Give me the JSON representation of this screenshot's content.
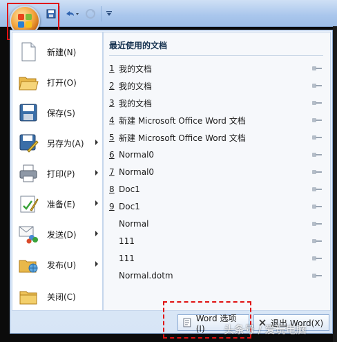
{
  "qat": {
    "save_icon": "save-icon",
    "undo_icon": "undo-icon",
    "redo_icon": "redo-icon",
    "customize_icon": "customize-qat-icon"
  },
  "menu": {
    "commands": [
      {
        "label": "新建(N)",
        "icon": "new-doc-icon",
        "has_submenu": false
      },
      {
        "label": "打开(O)",
        "icon": "open-folder-icon",
        "has_submenu": false
      },
      {
        "label": "保存(S)",
        "icon": "save-disk-icon",
        "has_submenu": false
      },
      {
        "label": "另存为(A)",
        "icon": "save-as-icon",
        "has_submenu": true
      },
      {
        "label": "打印(P)",
        "icon": "print-icon",
        "has_submenu": true
      },
      {
        "label": "准备(E)",
        "icon": "prepare-icon",
        "has_submenu": true
      },
      {
        "label": "发送(D)",
        "icon": "send-icon",
        "has_submenu": true
      },
      {
        "label": "发布(U)",
        "icon": "publish-icon",
        "has_submenu": true
      },
      {
        "label": "关闭(C)",
        "icon": "close-folder-icon",
        "has_submenu": false
      }
    ],
    "recent_title": "最近使用的文档",
    "recent_docs": [
      {
        "num": "1",
        "name": "我的文档"
      },
      {
        "num": "2",
        "name": "我的文档"
      },
      {
        "num": "3",
        "name": "我的文档"
      },
      {
        "num": "4",
        "name": "新建 Microsoft Office Word 文档"
      },
      {
        "num": "5",
        "name": "新建 Microsoft Office Word 文档"
      },
      {
        "num": "6",
        "name": "Normal0"
      },
      {
        "num": "7",
        "name": "Normal0"
      },
      {
        "num": "8",
        "name": "Doc1"
      },
      {
        "num": "9",
        "name": "Doc1"
      },
      {
        "num": "",
        "name": "Normal"
      },
      {
        "num": "",
        "name": "111"
      },
      {
        "num": "",
        "name": "111"
      },
      {
        "num": "",
        "name": "Normal.dotm"
      }
    ],
    "word_options_label": "Word 选项(I)",
    "exit_word_label": "退出 Word(X)"
  },
  "watermark": "头条号 / 爱玩电脑",
  "colors": {
    "highlight": "#e01010",
    "menu_bg": "#e9f1fb",
    "border": "#8aa9d2"
  }
}
